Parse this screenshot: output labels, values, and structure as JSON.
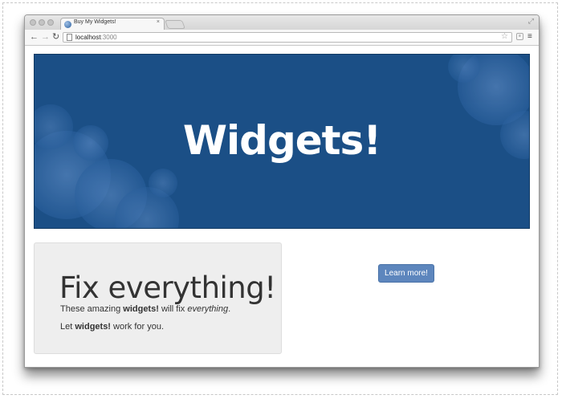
{
  "browser": {
    "tab_title": "Buy My Widgets!",
    "tab_close": "×",
    "url_host": "localhost",
    "url_port": ":3000",
    "icons": {
      "back": "back-arrow-icon",
      "forward": "forward-arrow-icon",
      "reload": "reload-icon",
      "star": "star-icon",
      "menu": "hamburger-menu-icon"
    }
  },
  "hero": {
    "title": "Widgets!",
    "background_color": "#1b4f86"
  },
  "card": {
    "heading": "Fix everything!",
    "line1_prefix": "These amazing ",
    "line1_bold": "widgets!",
    "line1_mid": " will fix ",
    "line1_italic": "everything",
    "line1_suffix": ".",
    "line2_prefix": "Let ",
    "line2_bold": "widgets!",
    "line2_suffix": " work for you."
  },
  "cta": {
    "label": "Learn more!",
    "color": "#5d86bd"
  }
}
